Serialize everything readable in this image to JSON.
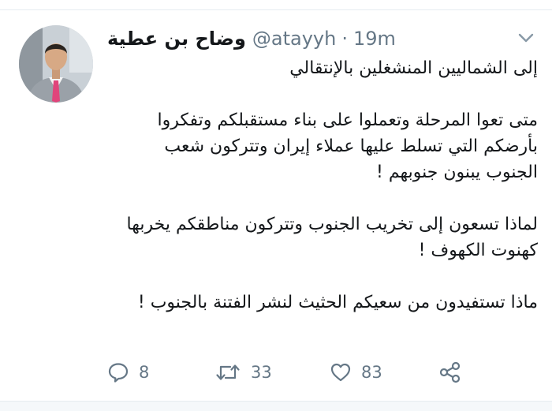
{
  "tweet": {
    "display_name": "وضاح بن عطية",
    "handle": "@atayyh",
    "separator": "·",
    "time": "19m",
    "lines": [
      "إلى الشماليين المنشغلين بالإنتقالي",
      "متى تعوا المرحلة وتعملوا على بناء مستقبلكم وتفكروا",
      "بأرضكم التي تسلط عليها عملاء إيران وتتركون شعب",
      "الجنوب يبنون جنوبهم !",
      "لماذا تسعون إلى تخريب الجنوب وتتركون مناطقكم يخربها",
      "كهنوت الكهوف !",
      "ماذا تستفيدون من سعيكم الحثيث لنشر الفتنة بالجنوب !"
    ]
  },
  "actions": {
    "reply_count": "8",
    "retweet_count": "33",
    "like_count": "83"
  },
  "icons": {
    "reply": "speech-bubble-icon",
    "retweet": "retweet-arrows-icon",
    "like": "heart-outline-icon",
    "share": "share-nodes-icon",
    "menu": "chevron-down-icon"
  },
  "colors": {
    "text": "#14171a",
    "secondary": "#657786",
    "divider": "#e6ecf0"
  }
}
